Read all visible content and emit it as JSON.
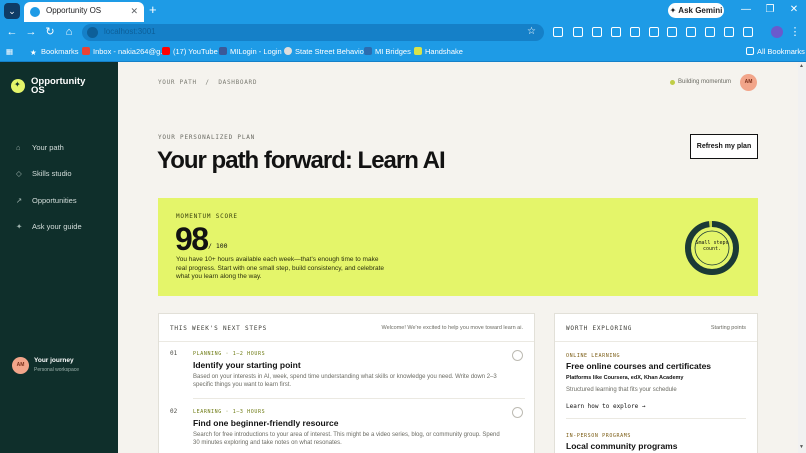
{
  "browser": {
    "tab_title": "Opportunity OS",
    "tab_close": "✕",
    "new_tab": "+",
    "address": "localhost:3001",
    "gemini_label": "✦ Ask Gemini",
    "bookmarks": [
      {
        "label": "Bookmarks",
        "color": "#ffffff"
      },
      {
        "label": "Inbox - nakia264@g...",
        "color": "#ea4335"
      },
      {
        "label": "(17) YouTube",
        "color": "#ff0000"
      },
      {
        "label": "MILogin - Login",
        "color": "#3b5998"
      },
      {
        "label": "State Street Behavio...",
        "color": "#dddddd"
      },
      {
        "label": "MI Bridges",
        "color": "#2b6cb0"
      },
      {
        "label": "Handshake",
        "color": "#d8e34a"
      }
    ],
    "all_bookmarks": "All Bookmarks"
  },
  "sidebar": {
    "brand": "Opportunity OS",
    "items": [
      {
        "icon": "home-icon",
        "glyph": "⌂",
        "label": "Your path"
      },
      {
        "icon": "diamond-icon",
        "glyph": "◇",
        "label": "Skills studio"
      },
      {
        "icon": "arrow-icon",
        "glyph": "↗",
        "label": "Opportunities"
      },
      {
        "icon": "sparkle-icon",
        "glyph": "✦",
        "label": "Ask your guide"
      }
    ],
    "journey": {
      "initials": "AM",
      "title": "Your journey",
      "subtitle": "Personal workspace"
    }
  },
  "header": {
    "breadcrumb": "YOUR PATH  /  DASHBOARD",
    "status": "Building momentum",
    "avatar_initials": "AM"
  },
  "plan": {
    "eyebrow": "YOUR PERSONALIZED PLAN",
    "title": "Your path forward: Learn AI",
    "refresh_label": "Refresh my plan"
  },
  "momentum": {
    "eyebrow": "MOMENTUM SCORE",
    "score": "98",
    "max": "/ 100",
    "score_fraction": 0.98,
    "description": "You have 10+ hours available each week—that's enough time to make real progress. Start with one small step, build consistency, and celebrate what you learn along the way.",
    "ring_label": "Small steps count.",
    "colors": {
      "accent": "#e4f56a",
      "ring": "#1b3a36"
    }
  },
  "next_steps": {
    "heading": "THIS WEEK'S NEXT STEPS",
    "welcome": "Welcome! We're excited to help you move toward learn ai.",
    "items": [
      {
        "num": "01",
        "tag": "PLANNING · 1–2 HOURS",
        "title": "Identify your starting point",
        "desc": "Based on your interests in AI, week, spend time understanding what skills or knowledge you need. Write down 2–3 specific things you want to learn first."
      },
      {
        "num": "02",
        "tag": "LEARNING · 1–3 HOURS",
        "title": "Find one beginner-friendly resource",
        "desc": "Search for free introductions to your area of interest. This might be a video series, blog, or community group. Spend 30 minutes exploring and take notes on what resonates."
      }
    ]
  },
  "explore": {
    "heading": "WORTH EXPLORING",
    "aside": "Starting points",
    "items": [
      {
        "tag": "ONLINE LEARNING",
        "title": "Free online courses and certificates",
        "sub": "Platforms like Coursera, edX, Khan Academy",
        "desc": "Structured learning that fits your schedule",
        "link": "Learn how to explore →"
      },
      {
        "tag": "IN-PERSON PROGRAMS",
        "title": "Local community programs"
      }
    ]
  }
}
